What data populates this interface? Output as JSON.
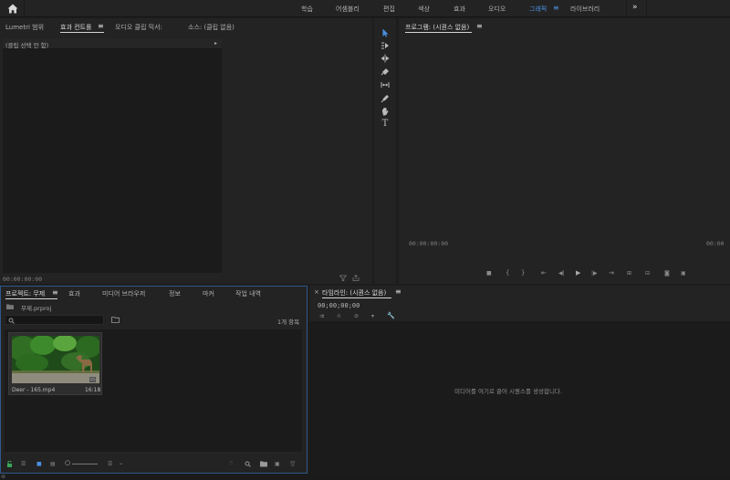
{
  "topbar": {
    "workspaces": [
      "학습",
      "어셈블리",
      "편집",
      "색상",
      "효과",
      "오디오",
      "그래픽",
      "라이브러리"
    ],
    "active_workspace": "그래픽",
    "menu_glyph": "≡",
    "more_glyph": "»"
  },
  "source_panel": {
    "tabs": [
      "Lumetri 범위",
      "효과 컨트롤",
      "오디오 클립 믹서:",
      "소스: (클립 없음)"
    ],
    "active_tab_menu": "≡",
    "no_clip_text": "(클립 선택 안 함)",
    "timecode": "00:00:00:00"
  },
  "tools_panel": {
    "tools": [
      "selection-tool-icon",
      "track-select-tool-icon",
      "ripple-edit-tool-icon",
      "razor-tool-icon",
      "slip-tool-icon",
      "pen-tool-icon",
      "hand-tool-icon",
      "type-tool-icon"
    ]
  },
  "program_monitor": {
    "title": "프로그램: (시퀀스 없음)",
    "menu_glyph": "≡",
    "timecode_left": "00:00:00:00",
    "timecode_right": "00:00"
  },
  "project_panel": {
    "tabs": [
      "프로젝트: 무제",
      "효과",
      "미디어 브라우저",
      "정보",
      "마커",
      "작업 내역"
    ],
    "active_tab_menu": "≡",
    "project_file": "무제.prproj",
    "item_count": "1개 항목",
    "search_placeholder": "",
    "clip": {
      "name": "Deer - 165.mp4",
      "duration": "16:18"
    }
  },
  "timeline_panel": {
    "title": "타임라인: (시퀀스 없음)",
    "close_glyph": "×",
    "menu_glyph": "≡",
    "timecode": "00;00;00;00",
    "empty_message": "미디어를 여기로 끌어 시퀀스를 생성합니다."
  },
  "colors": {
    "accent": "#4a90e2",
    "panel_bg": "#232323",
    "dark_bg": "#1b1b1b",
    "focus_border": "#2d5a8a"
  }
}
